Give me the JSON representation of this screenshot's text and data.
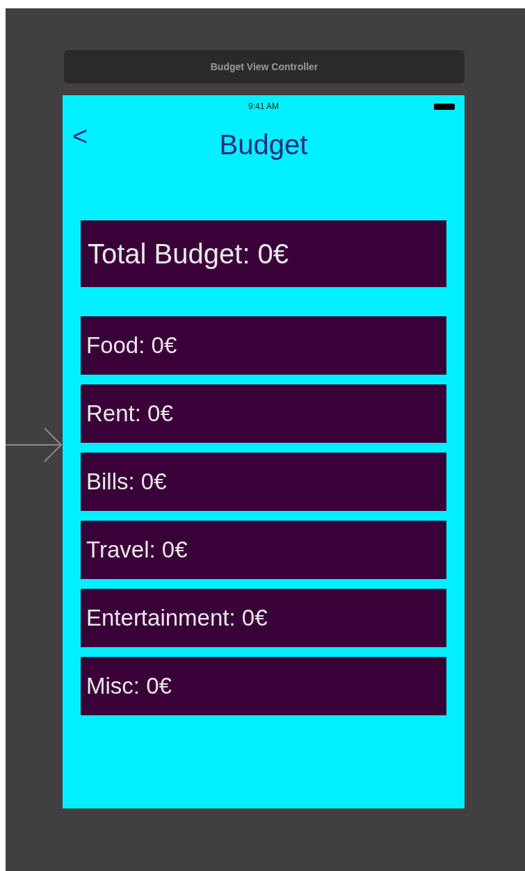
{
  "scene_title": "Budget View Controller",
  "status_bar": {
    "time": "9:41 AM"
  },
  "nav": {
    "back": "<",
    "title": "Budget"
  },
  "total": "Total Budget: 0€",
  "categories": [
    "Food: 0€",
    "Rent: 0€",
    "Bills: 0€",
    "Travel: 0€",
    "Entertainment: 0€",
    "Misc: 0€"
  ]
}
